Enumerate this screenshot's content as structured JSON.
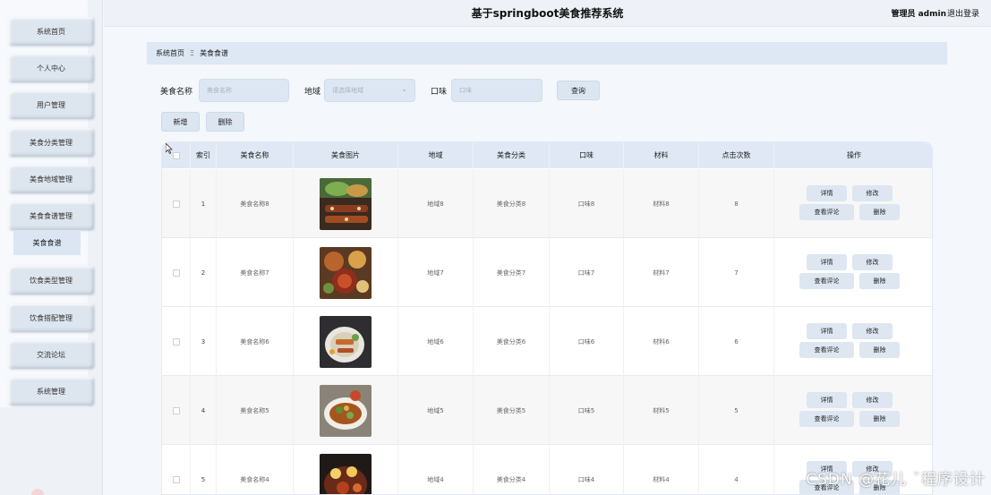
{
  "header": {
    "title": "基于springboot美食推荐系统",
    "user": "管理员 admin",
    "logout": "退出登录"
  },
  "sidebar": {
    "items": [
      {
        "label": "系统首页"
      },
      {
        "label": "个人中心"
      },
      {
        "label": "用户管理"
      },
      {
        "label": "美食分类管理"
      },
      {
        "label": "美食地域管理"
      },
      {
        "label": "美食食谱管理"
      },
      {
        "label": "饮食类型管理"
      },
      {
        "label": "饮食搭配管理"
      },
      {
        "label": "交流论坛"
      },
      {
        "label": "系统管理"
      }
    ],
    "sub_item": "美食食谱"
  },
  "breadcrumb": {
    "home": "系统首页",
    "sep": "Ξ",
    "current": "美食食谱"
  },
  "search": {
    "name_label": "美食名称",
    "name_placeholder": "美食名称",
    "region_label": "地域",
    "region_placeholder": "请选择地域",
    "taste_label": "口味",
    "taste_placeholder": "口味",
    "query_button": "查询"
  },
  "actions": {
    "add": "新增",
    "delete": "删除"
  },
  "table": {
    "columns": [
      "索引",
      "美食名称",
      "美食图片",
      "地域",
      "美食分类",
      "口味",
      "材料",
      "点击次数",
      "操作"
    ],
    "rows": [
      {
        "index": "1",
        "name": "美食名称8",
        "region": "地域8",
        "category": "美食分类8",
        "taste": "口味8",
        "material": "材料8",
        "clicks": "8"
      },
      {
        "index": "2",
        "name": "美食名称7",
        "region": "地域7",
        "category": "美食分类7",
        "taste": "口味7",
        "material": "材料7",
        "clicks": "7"
      },
      {
        "index": "3",
        "name": "美食名称6",
        "region": "地域6",
        "category": "美食分类6",
        "taste": "口味6",
        "material": "材料6",
        "clicks": "6"
      },
      {
        "index": "4",
        "name": "美食名称5",
        "region": "地域5",
        "category": "美食分类5",
        "taste": "口味5",
        "material": "材料5",
        "clicks": "5"
      },
      {
        "index": "5",
        "name": "美食名称4",
        "region": "地域4",
        "category": "美食分类4",
        "taste": "口味4",
        "material": "材料4",
        "clicks": "4"
      }
    ],
    "op_labels": {
      "detail": "详情",
      "edit": "修改",
      "review": "查看评论",
      "delete": "删除"
    }
  },
  "watermark": "CSDN @花儿 ˇ程序设计"
}
